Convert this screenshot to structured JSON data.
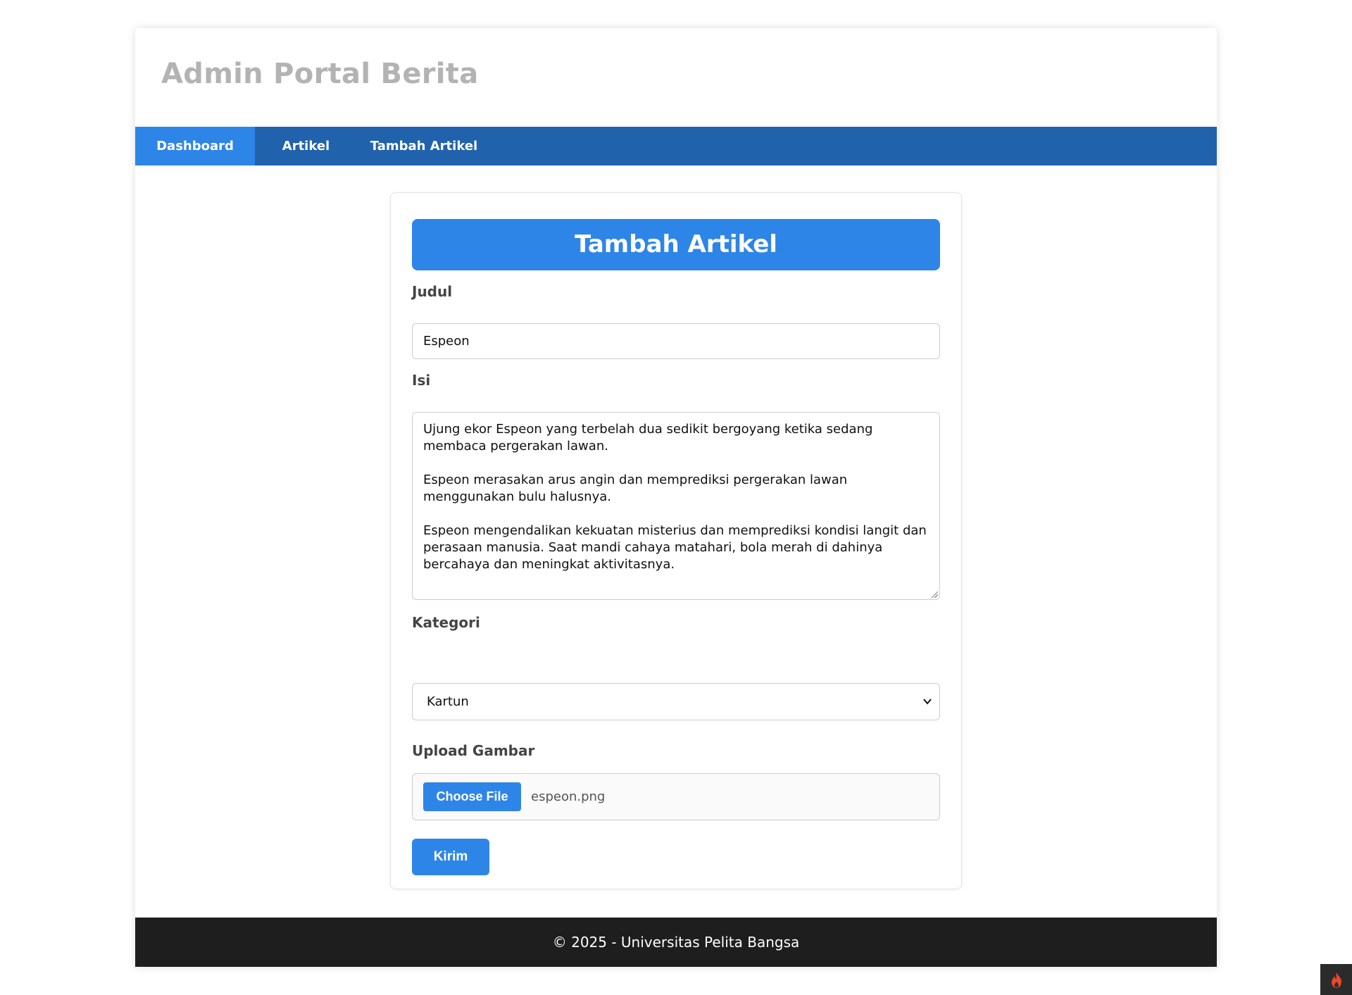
{
  "header": {
    "title": "Admin Portal Berita"
  },
  "nav": {
    "items": [
      {
        "label": "Dashboard",
        "active": true
      },
      {
        "label": "Artikel",
        "active": false
      },
      {
        "label": "Tambah Artikel",
        "active": false
      }
    ]
  },
  "form": {
    "title": "Tambah Artikel",
    "judul": {
      "label": "Judul",
      "value": "Espeon"
    },
    "isi": {
      "label": "Isi",
      "paragraphs": [
        "Ujung ekor Espeon yang terbelah dua sedikit bergoyang ketika sedang membaca pergerakan lawan.",
        "Espeon merasakan arus angin dan memprediksi pergerakan lawan menggunakan bulu halusnya.",
        "Espeon mengendalikan kekuatan misterius dan memprediksi kondisi langit dan perasaan manusia. Saat mandi cahaya matahari, bola merah di dahinya bercahaya dan meningkat aktivitasnya."
      ]
    },
    "kategori": {
      "label": "Kategori",
      "selected": "Kartun"
    },
    "upload": {
      "label": "Upload Gambar",
      "button_label": "Choose File",
      "file_name": "espeon.png"
    },
    "submit_label": "Kirim"
  },
  "footer": {
    "text": "© 2025 - Universitas Pelita Bangsa"
  },
  "colors": {
    "primary": "#2e85e8",
    "nav_bg": "#2162ad",
    "footer_bg": "#1e1e1e",
    "title_gray": "#b3b3b3"
  },
  "icons": {
    "corner_widget": "flame-icon",
    "select_chevron": "chevron-down-icon"
  }
}
